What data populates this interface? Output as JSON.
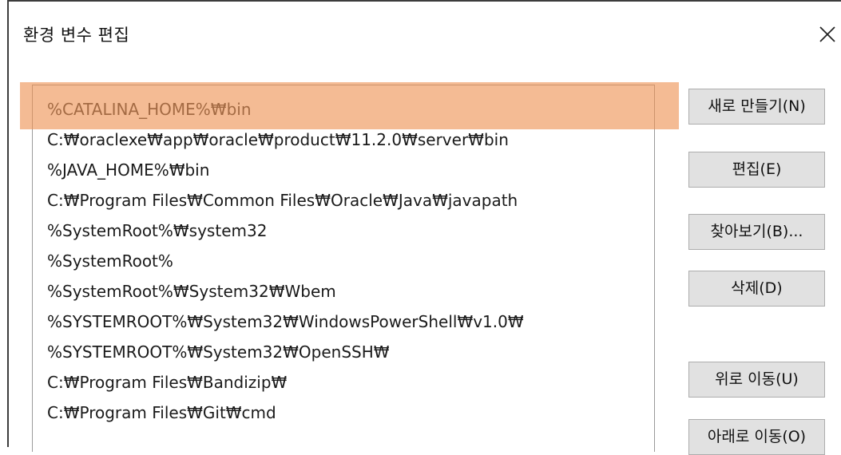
{
  "dialog": {
    "title": "환경 변수 편집",
    "close_symbol": "close-icon"
  },
  "path_list": [
    "%CATALINA_HOME%₩bin",
    "C:₩oraclexe₩app₩oracle₩product₩11.2.0₩server₩bin",
    "%JAVA_HOME%₩bin",
    "C:₩Program Files₩Common Files₩Oracle₩Java₩javapath",
    "%SystemRoot%₩system32",
    "%SystemRoot%",
    "%SystemRoot%₩System32₩Wbem",
    "%SYSTEMROOT%₩System32₩WindowsPowerShell₩v1.0₩",
    "%SYSTEMROOT%₩System32₩OpenSSH₩",
    "C:₩Program Files₩Bandizip₩",
    "C:₩Program Files₩Git₩cmd"
  ],
  "selected_index": 0,
  "buttons": {
    "new": "새로 만들기(N)",
    "edit": "편집(E)",
    "browse": "찾아보기(B)...",
    "delete": "삭제(D)",
    "move_up": "위로 이동(U)",
    "move_down": "아래로 이동(O)"
  },
  "colors": {
    "highlight": "#ee9252",
    "button_bg": "#e1e1e1",
    "button_border": "#adadad",
    "list_border": "#9a9a9a"
  }
}
